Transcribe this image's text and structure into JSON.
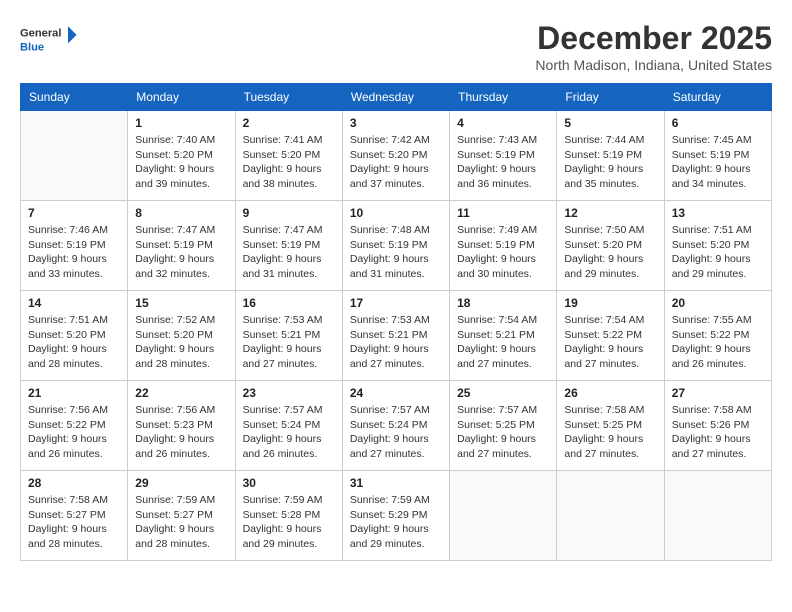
{
  "header": {
    "logo_line1": "General",
    "logo_line2": "Blue",
    "month": "December 2025",
    "location": "North Madison, Indiana, United States"
  },
  "weekdays": [
    "Sunday",
    "Monday",
    "Tuesday",
    "Wednesday",
    "Thursday",
    "Friday",
    "Saturday"
  ],
  "weeks": [
    [
      {
        "day": "",
        "info": ""
      },
      {
        "day": "1",
        "info": "Sunrise: 7:40 AM\nSunset: 5:20 PM\nDaylight: 9 hours\nand 39 minutes."
      },
      {
        "day": "2",
        "info": "Sunrise: 7:41 AM\nSunset: 5:20 PM\nDaylight: 9 hours\nand 38 minutes."
      },
      {
        "day": "3",
        "info": "Sunrise: 7:42 AM\nSunset: 5:20 PM\nDaylight: 9 hours\nand 37 minutes."
      },
      {
        "day": "4",
        "info": "Sunrise: 7:43 AM\nSunset: 5:19 PM\nDaylight: 9 hours\nand 36 minutes."
      },
      {
        "day": "5",
        "info": "Sunrise: 7:44 AM\nSunset: 5:19 PM\nDaylight: 9 hours\nand 35 minutes."
      },
      {
        "day": "6",
        "info": "Sunrise: 7:45 AM\nSunset: 5:19 PM\nDaylight: 9 hours\nand 34 minutes."
      }
    ],
    [
      {
        "day": "7",
        "info": "Sunrise: 7:46 AM\nSunset: 5:19 PM\nDaylight: 9 hours\nand 33 minutes."
      },
      {
        "day": "8",
        "info": "Sunrise: 7:47 AM\nSunset: 5:19 PM\nDaylight: 9 hours\nand 32 minutes."
      },
      {
        "day": "9",
        "info": "Sunrise: 7:47 AM\nSunset: 5:19 PM\nDaylight: 9 hours\nand 31 minutes."
      },
      {
        "day": "10",
        "info": "Sunrise: 7:48 AM\nSunset: 5:19 PM\nDaylight: 9 hours\nand 31 minutes."
      },
      {
        "day": "11",
        "info": "Sunrise: 7:49 AM\nSunset: 5:19 PM\nDaylight: 9 hours\nand 30 minutes."
      },
      {
        "day": "12",
        "info": "Sunrise: 7:50 AM\nSunset: 5:20 PM\nDaylight: 9 hours\nand 29 minutes."
      },
      {
        "day": "13",
        "info": "Sunrise: 7:51 AM\nSunset: 5:20 PM\nDaylight: 9 hours\nand 29 minutes."
      }
    ],
    [
      {
        "day": "14",
        "info": "Sunrise: 7:51 AM\nSunset: 5:20 PM\nDaylight: 9 hours\nand 28 minutes."
      },
      {
        "day": "15",
        "info": "Sunrise: 7:52 AM\nSunset: 5:20 PM\nDaylight: 9 hours\nand 28 minutes."
      },
      {
        "day": "16",
        "info": "Sunrise: 7:53 AM\nSunset: 5:21 PM\nDaylight: 9 hours\nand 27 minutes."
      },
      {
        "day": "17",
        "info": "Sunrise: 7:53 AM\nSunset: 5:21 PM\nDaylight: 9 hours\nand 27 minutes."
      },
      {
        "day": "18",
        "info": "Sunrise: 7:54 AM\nSunset: 5:21 PM\nDaylight: 9 hours\nand 27 minutes."
      },
      {
        "day": "19",
        "info": "Sunrise: 7:54 AM\nSunset: 5:22 PM\nDaylight: 9 hours\nand 27 minutes."
      },
      {
        "day": "20",
        "info": "Sunrise: 7:55 AM\nSunset: 5:22 PM\nDaylight: 9 hours\nand 26 minutes."
      }
    ],
    [
      {
        "day": "21",
        "info": "Sunrise: 7:56 AM\nSunset: 5:22 PM\nDaylight: 9 hours\nand 26 minutes."
      },
      {
        "day": "22",
        "info": "Sunrise: 7:56 AM\nSunset: 5:23 PM\nDaylight: 9 hours\nand 26 minutes."
      },
      {
        "day": "23",
        "info": "Sunrise: 7:57 AM\nSunset: 5:24 PM\nDaylight: 9 hours\nand 26 minutes."
      },
      {
        "day": "24",
        "info": "Sunrise: 7:57 AM\nSunset: 5:24 PM\nDaylight: 9 hours\nand 27 minutes."
      },
      {
        "day": "25",
        "info": "Sunrise: 7:57 AM\nSunset: 5:25 PM\nDaylight: 9 hours\nand 27 minutes."
      },
      {
        "day": "26",
        "info": "Sunrise: 7:58 AM\nSunset: 5:25 PM\nDaylight: 9 hours\nand 27 minutes."
      },
      {
        "day": "27",
        "info": "Sunrise: 7:58 AM\nSunset: 5:26 PM\nDaylight: 9 hours\nand 27 minutes."
      }
    ],
    [
      {
        "day": "28",
        "info": "Sunrise: 7:58 AM\nSunset: 5:27 PM\nDaylight: 9 hours\nand 28 minutes."
      },
      {
        "day": "29",
        "info": "Sunrise: 7:59 AM\nSunset: 5:27 PM\nDaylight: 9 hours\nand 28 minutes."
      },
      {
        "day": "30",
        "info": "Sunrise: 7:59 AM\nSunset: 5:28 PM\nDaylight: 9 hours\nand 29 minutes."
      },
      {
        "day": "31",
        "info": "Sunrise: 7:59 AM\nSunset: 5:29 PM\nDaylight: 9 hours\nand 29 minutes."
      },
      {
        "day": "",
        "info": ""
      },
      {
        "day": "",
        "info": ""
      },
      {
        "day": "",
        "info": ""
      }
    ]
  ]
}
